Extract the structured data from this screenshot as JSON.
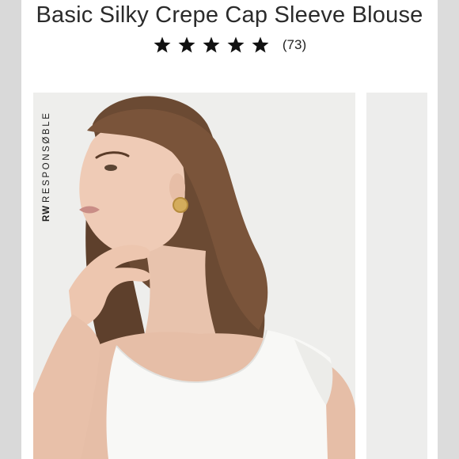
{
  "product": {
    "title": "Basic Silky Crepe Cap Sleeve Blouse",
    "rating": {
      "stars": 5,
      "max_stars": 5,
      "count_label": "(73)"
    }
  },
  "gallery": {
    "badge_bold": "RW",
    "badge_text": "RESPONSØBLE",
    "main_image": "model-wearing-white-blouse",
    "next_image": "partial-next-image"
  },
  "colors": {
    "background": "#ffffff",
    "side_edges": "#d9d9d9",
    "text": "#2b2b2b",
    "star": "#111111",
    "photo_backdrop": "#eeeeec",
    "blouse": "#f8f8f6",
    "hair": "#6b4a33"
  },
  "icons": {
    "star": "filled-star-icon"
  }
}
